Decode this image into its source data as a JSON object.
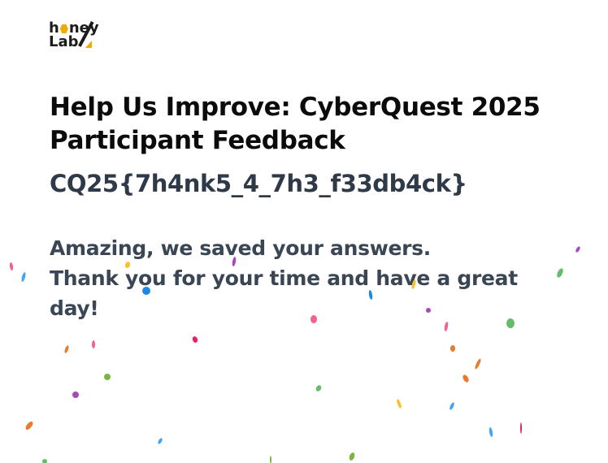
{
  "brand": {
    "logo_line1": "honey",
    "logo_line2": "Lab",
    "accent_color": "#f2a900"
  },
  "form": {
    "title": "Help Us Improve: CyberQuest 2025 Participant Feedback",
    "flag": "CQ25{7h4nk5_4_7h3_f33db4ck}",
    "confirmation_line1": "Amazing, we saved your answers.",
    "confirmation_line2": "Thank you for your time and have a great day!"
  },
  "decoration": {
    "type": "confetti",
    "colors": [
      "#1e88e5",
      "#f06292",
      "#66bb6a",
      "#e57c2e",
      "#fbc02d",
      "#e91e63",
      "#7cb342",
      "#42a5f5",
      "#ab47bc",
      "#26a69a"
    ]
  }
}
